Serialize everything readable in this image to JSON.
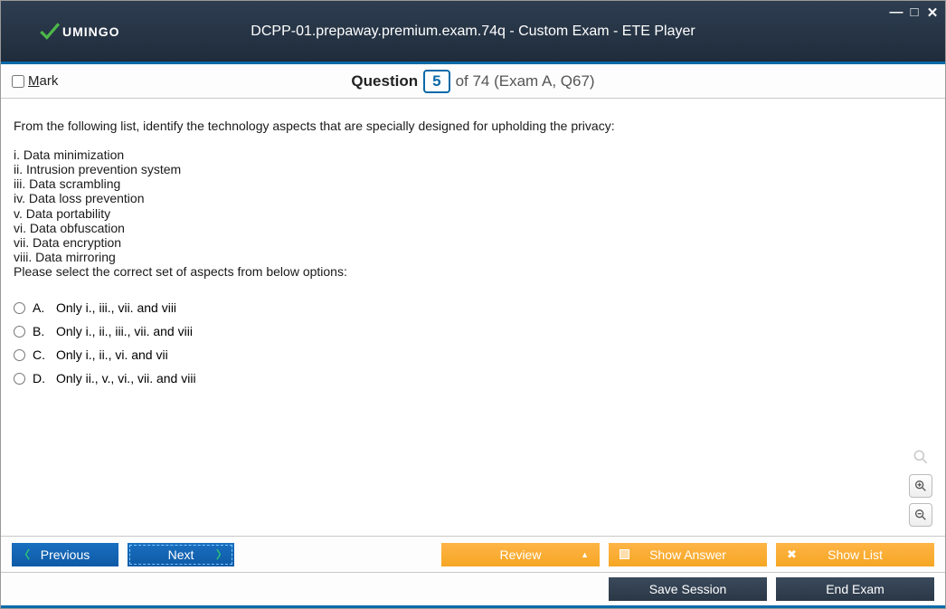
{
  "app": {
    "logo_text": "UMINGO",
    "title": "DCPP-01.prepaway.premium.exam.74q - Custom Exam - ETE Player"
  },
  "qbar": {
    "mark_label_pre": "M",
    "mark_label_rest": "ark",
    "question_label": "Question",
    "current": "5",
    "of_text": "of 74 (Exam A, Q67)"
  },
  "stem": {
    "intro": "From the following list, identify the technology aspects that are specially designed for upholding the privacy:",
    "lines": [
      "i. Data minimization",
      "ii. Intrusion prevention system",
      "iii. Data scrambling",
      "iv. Data loss prevention",
      "v. Data portability",
      "vi. Data obfuscation",
      "vii. Data encryption",
      "viii. Data mirroring"
    ],
    "prompt": "Please select the correct set of aspects from below options:"
  },
  "options": [
    {
      "letter": "A.",
      "text": "Only i., iii., vii. and viii"
    },
    {
      "letter": "B.",
      "text": "Only i., ii., iii., vii. and viii"
    },
    {
      "letter": "C.",
      "text": "Only i., ii., vi. and vii"
    },
    {
      "letter": "D.",
      "text": "Only ii., v., vi., vii. and viii"
    }
  ],
  "buttons": {
    "previous": "Previous",
    "next": "Next",
    "review": "Review",
    "show_answer": "Show Answer",
    "show_list": "Show List",
    "save_session": "Save Session",
    "end_exam": "End Exam"
  }
}
